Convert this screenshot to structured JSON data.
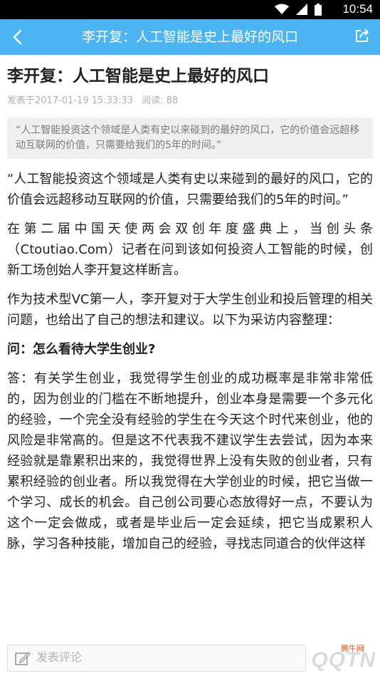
{
  "status_bar": {
    "time": "10:54"
  },
  "nav": {
    "title": "李开复：人工智能是史上最好的风口"
  },
  "article": {
    "title": "李开复：人工智能是史上最好的风口",
    "meta": {
      "published": "发表于2017-01-19 15:33:33",
      "reads": "阅读: 88"
    },
    "summary": "“人工智能投资这个领域是人类有史以来碰到的最好的风口，它的价值会远超移动互联网的价值，只需要给我们的5年的时间。”",
    "paragraphs": [
      "“人工智能投资这个领域是人类有史以来碰到的最好的风口，它的价值会远超移动互联网的价值，只需要给我们的5年的时间。”",
      "在第二届中国天使两会双创年度盛典上，当创头条（Ctoutiao.Com）记者在问到该如何投资人工智能的时候，创新工场创始人李开复这样断言。",
      "作为技术型VC第一人，李开复对于大学生创业和投后管理的相关问题，也给出了自己的想法和建议。以下为采访内容整理：",
      "答：有关学生创业，我觉得学生创业的成功概率是非常非常低的，因为创业的门槛在不断地提升，创业本身是需要一个多元化的经验，一个完全没有经验的学生在今天这个时代来创业，他的风险是非常高的。但是这不代表我不建议学生去尝试，因为本来经验就是靠累积出来的，我觉得世界上没有失败的创业者，只有累积经验的创业者。所以我觉得在大学创业的时候，把它当做一个学习、成长的机会。自己创公司要心态放得好一点，不要认为这个一定会做成，或者是毕业后一定会延续，把它当成累积人脉，学习各种技能，增加自己的经验，寻找志同道合的伙伴这样"
    ],
    "qa_heading": "问：怎么看待大学生创业?"
  },
  "footer": {
    "comment_placeholder": "发表评论"
  },
  "watermark": {
    "text": "QQTN",
    "small": "腾牛网"
  },
  "colors": {
    "nav_bg": "#4db4f4",
    "status_bg": "#000000",
    "summary_bg": "#efefef"
  }
}
